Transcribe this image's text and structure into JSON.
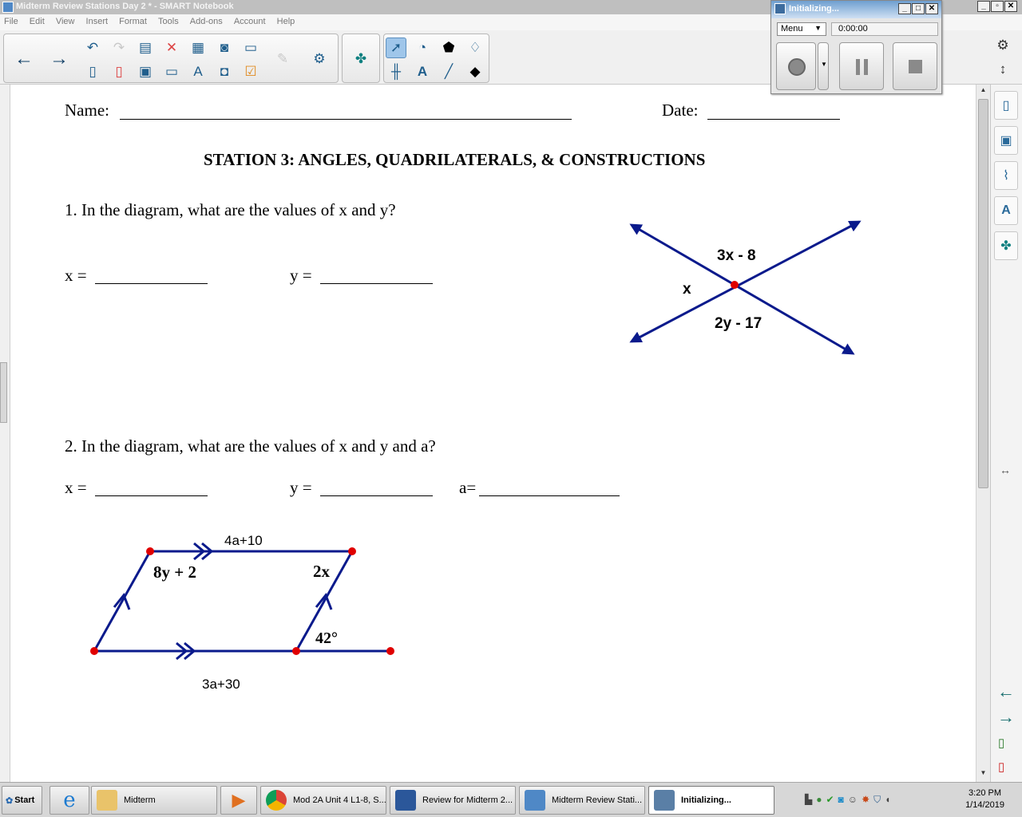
{
  "window": {
    "title": "Midterm Review Stations Day 2 * - SMART Notebook",
    "minimize": "_",
    "maximize": "▫",
    "close": "✕"
  },
  "menu": [
    "File",
    "Edit",
    "View",
    "Insert",
    "Format",
    "Tools",
    "Add-ons",
    "Account",
    "Help"
  ],
  "recorder": {
    "title": "Initializing...",
    "menu_label": "Menu",
    "time": "0:00:00",
    "minimize": "_",
    "maximize": "□",
    "close": "✕"
  },
  "worksheet": {
    "name_label": "Name:",
    "date_label": "Date:",
    "heading": "STATION 3: ANGLES, QUADRILATERALS, & CONSTRUCTIONS",
    "q1": {
      "text": "1. In the diagram, what are the values of x and y?",
      "x_label": "x =",
      "y_label": "y ="
    },
    "q2": {
      "text": "2. In the diagram, what are the values of x and y and a?",
      "x_label": "x =",
      "y_label": "y =",
      "a_label": "a="
    },
    "diagram1": {
      "label_top": "3x - 8",
      "label_left": "x",
      "label_bottom": "2y - 17",
      "line_color": "#0a1a8c",
      "point_color": "#e00000"
    },
    "diagram2": {
      "top_label": "4a+10",
      "angle_left": "8y + 2",
      "angle_right": "2x",
      "angle_bottom": "42°",
      "bottom_label": "3a+30",
      "line_color": "#0a1a8c",
      "point_color": "#e00000"
    }
  },
  "taskbar": {
    "start": "Start",
    "tasks": [
      {
        "label": "Midterm"
      },
      {
        "label": "Mod 2A Unit 4 L1-8, S..."
      },
      {
        "label": "Review for Midterm 2..."
      },
      {
        "label": "Midterm Review Stati..."
      },
      {
        "label": "Initializing..."
      }
    ],
    "time": "3:20 PM",
    "date": "1/14/2019"
  }
}
